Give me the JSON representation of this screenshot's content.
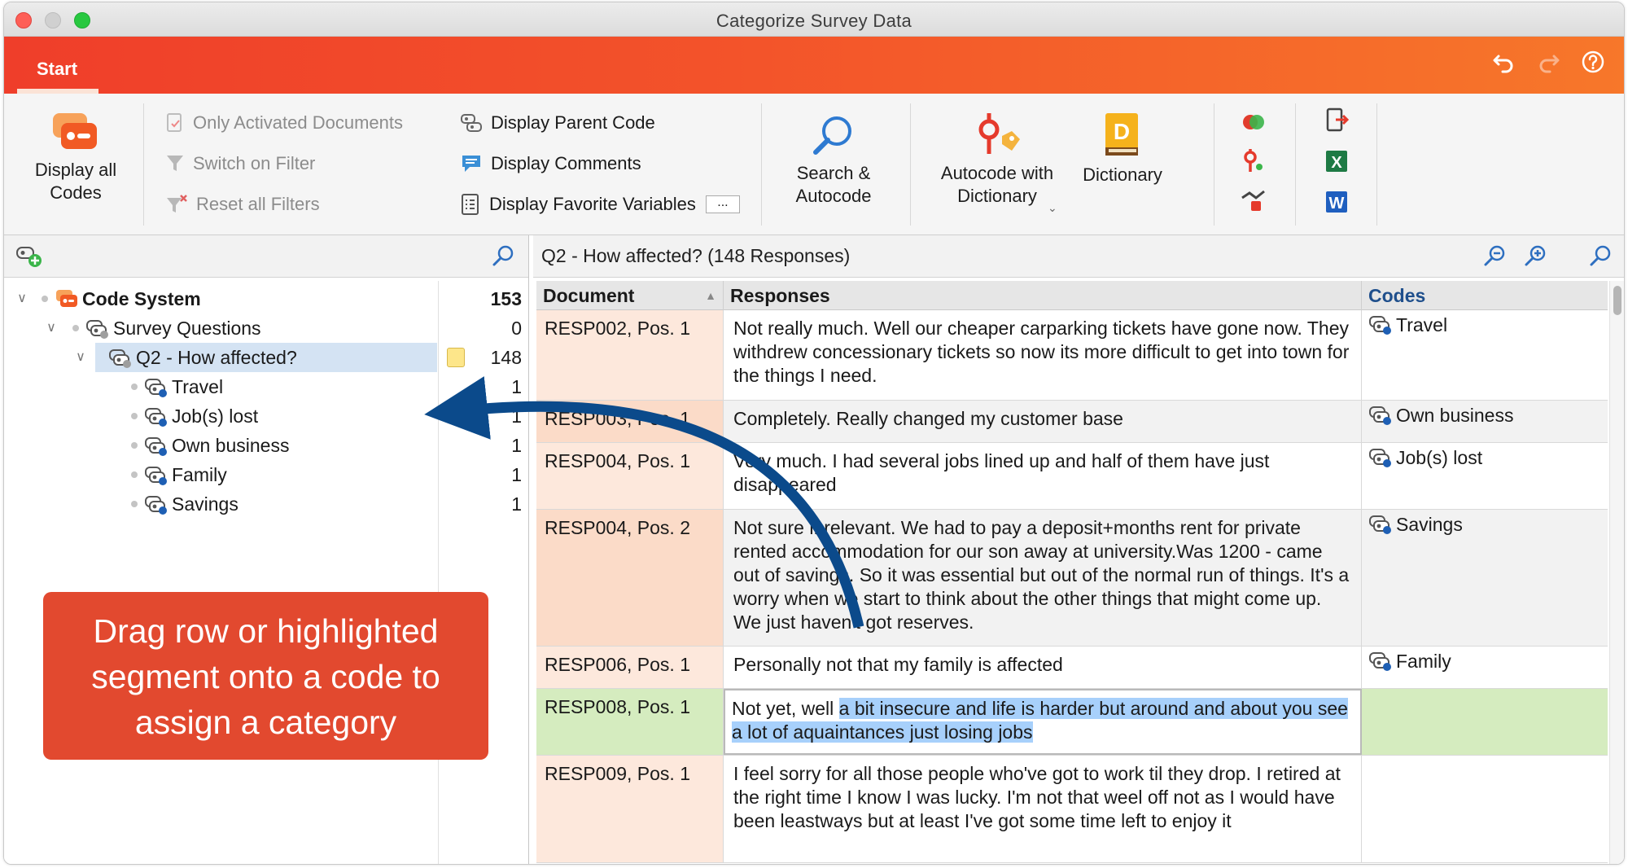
{
  "window": {
    "title": "Categorize Survey Data"
  },
  "tabbar": {
    "tab_label": "Start",
    "icons": [
      "undo-icon",
      "redo-icon",
      "help-icon"
    ]
  },
  "ribbon": {
    "display_all_codes": "Display all Codes",
    "filters": {
      "only_activated": "Only Activated Documents",
      "switch_on_filter": "Switch on Filter",
      "reset_filters": "Reset all Filters"
    },
    "display_options": {
      "parent_code": "Display Parent Code",
      "comments": "Display Comments",
      "favorite_variables": "Display Favorite Variables",
      "favorite_variables_more": "..."
    },
    "search_autocode": "Search & Autocode",
    "autocode_dictionary": "Autocode with Dictionary",
    "dictionary": "Dictionary",
    "colors": {
      "accent": "#f3532a",
      "excel": "#1e7a44",
      "word": "#1f5fbf"
    }
  },
  "code_tree": {
    "root": {
      "label": "Code System",
      "count": "153"
    },
    "group": {
      "label": "Survey Questions",
      "count": "0"
    },
    "question": {
      "label": "Q2 - How affected?",
      "count": "148"
    },
    "codes": [
      {
        "label": "Travel",
        "count": "1"
      },
      {
        "label": "Job(s) lost",
        "count": "1"
      },
      {
        "label": "Own business",
        "count": "1"
      },
      {
        "label": "Family",
        "count": "1"
      },
      {
        "label": "Savings",
        "count": "1"
      }
    ]
  },
  "callout": {
    "line1": "Drag row or highlighted",
    "line2": "segment onto a code to",
    "line3": "assign a category",
    "color": "#e2492f"
  },
  "grid": {
    "title": "Q2 - How affected? (148 Responses)",
    "headers": {
      "document": "Document",
      "responses": "Responses",
      "codes": "Codes"
    },
    "rows": [
      {
        "doc": "RESP002, Pos. 1",
        "response": "Not really much. Well our cheaper carparking tickets have gone now. They withdrew concessionary tickets so now its more difficult to get into town for the things I need.",
        "code": "Travel"
      },
      {
        "doc": "RESP003, Pos. 1",
        "response": "Completely. Really changed my customer base",
        "code": "Own business"
      },
      {
        "doc": "RESP004, Pos. 1",
        "response": "Very much. I had several jobs lined up and half of them have just disappeared",
        "code": "Job(s) lost"
      },
      {
        "doc": "RESP004, Pos. 2",
        "response": "Not sure if relevant. We had to pay a deposit+months rent for private rented accommodation for our son away at university.Was 1200 - came out of savings. So it was essential but out of the normal run of things. It's a worry when we start to think about the other things that might come up. We just haven't got reserves.",
        "code": "Savings"
      },
      {
        "doc": "RESP006, Pos. 1",
        "response": "Personally not that my family is affected",
        "code": "Family"
      },
      {
        "doc": "RESP008, Pos. 1",
        "response_plain": "Not yet, well ",
        "response_highlight": "a bit insecure and life is harder but around and about you see a lot of aquaintances just losing jobs",
        "code": ""
      },
      {
        "doc": "RESP009, Pos. 1",
        "response": "I feel sorry for all those people who've got to work til they drop. I retired at the right time I know I was lucky. I'm not that weel off not as I would have been leastways but at least I've got some time left to enjoy it",
        "code": ""
      }
    ]
  }
}
